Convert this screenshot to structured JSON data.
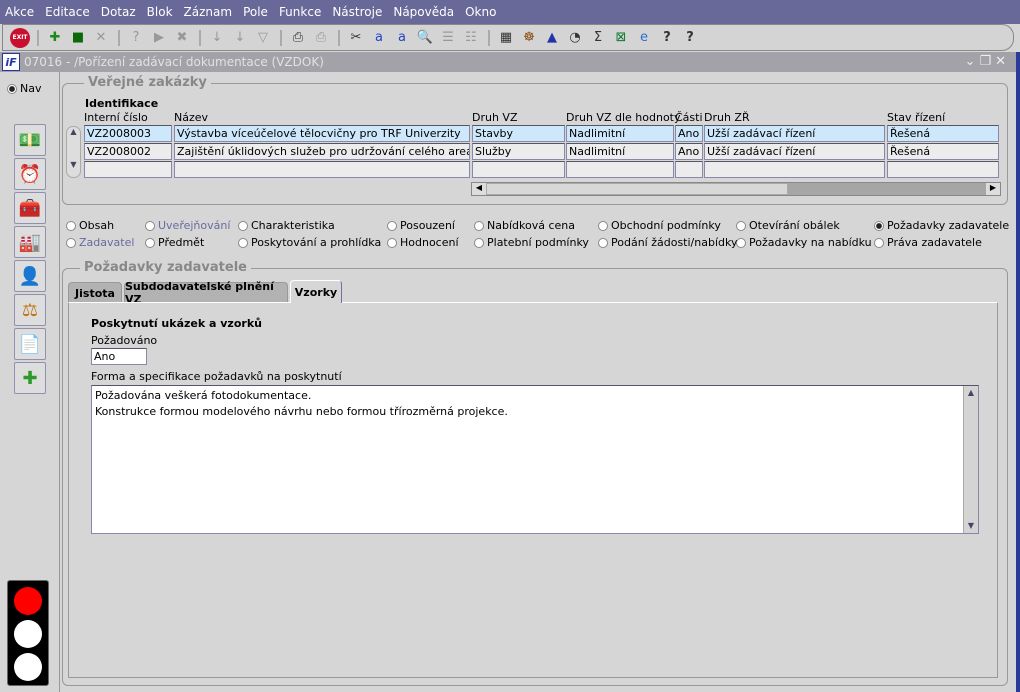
{
  "menu": [
    "Akce",
    "Editace",
    "Dotaz",
    "Blok",
    "Záznam",
    "Pole",
    "Funkce",
    "Nástroje",
    "Nápověda",
    "Okno"
  ],
  "toolbar": {
    "exit_label": "EXIT",
    "icons": [
      "exit-icon",
      "insert-record-icon",
      "save-icon",
      "delete-record-icon",
      "query-help-icon",
      "execute-query-icon",
      "cancel-query-icon",
      "sort-asc-icon",
      "sort-desc-icon",
      "filter-icon",
      "print-icon",
      "print-setup-icon",
      "cut-icon",
      "copy-icon",
      "paste-icon",
      "zoom-icon",
      "list-icon",
      "columns-icon",
      "export-icon",
      "navigator-icon",
      "alert-icon",
      "clock-icon",
      "sum-icon",
      "excel-icon",
      "internet-icon",
      "help-icon",
      "about-icon"
    ]
  },
  "window": {
    "title": "07016 - /Pořízení zadávací dokumentace (VZDOK)",
    "logo": "iF"
  },
  "sidebar": {
    "nav_label": "Nav",
    "buttons": [
      "money-icon",
      "clock-icon",
      "toolbox-icon",
      "factory-icon",
      "person-icon",
      "scales-icon",
      "document-icon",
      "new-document-icon"
    ]
  },
  "traffic_light": {
    "active": "red",
    "colors": {
      "red": "#ff0000",
      "off": "#ffffff"
    }
  },
  "zakazky": {
    "title": "Veřejné zakázky",
    "section": "Identifikace",
    "columns": [
      "Interní číslo",
      "Název",
      "Druh VZ",
      "Druh VZ dle hodnoty",
      "Části",
      "Druh ZŘ",
      "Stav řízení"
    ],
    "rows": [
      [
        "VZ2008003",
        "Výstavba víceúčelové tělocvičny pro TRF Univerzity",
        "Stavby",
        "Nadlimitní",
        "Ano",
        "Užší zadávací řízení",
        "Řešená"
      ],
      [
        "VZ2008002",
        "Zajištění úklidových služeb pro udržování celého areálu Univ",
        "Služby",
        "Nadlimitní",
        "Ano",
        "Užší zadávací řízení",
        "Řešená"
      ],
      [
        "",
        "",
        "",
        "",
        "",
        "",
        ""
      ]
    ]
  },
  "sections": [
    [
      {
        "label": "Obsah"
      },
      {
        "label": "Uveřejňování",
        "disabled": true
      },
      {
        "label": "Charakteristika"
      },
      {
        "label": "Posouzení"
      },
      {
        "label": "Nabídková cena"
      },
      {
        "label": "Obchodní podmínky"
      },
      {
        "label": "Otevírání obálek"
      },
      {
        "label": "Požadavky zadavatele",
        "selected": true
      }
    ],
    [
      {
        "label": "Zadavatel",
        "disabled": true
      },
      {
        "label": "Předmět"
      },
      {
        "label": "Poskytování a prohlídka"
      },
      {
        "label": "Hodnocení"
      },
      {
        "label": "Platební podmínky"
      },
      {
        "label": "Podání žádosti/nabídky"
      },
      {
        "label": "Požadavky na nabídku"
      },
      {
        "label": "Práva zadavatele"
      }
    ]
  ],
  "pozadavky": {
    "title": "Požadavky zadavatele",
    "tabs": [
      "Jistota",
      "Subdodavatelské plnění VZ",
      "Vzorky"
    ],
    "active_tab": "Vzorky",
    "heading": "Poskytnutí ukázek a vzorků",
    "pozadovano_label": "Požadováno",
    "pozadovano_value": "Ano",
    "forma_label": "Forma a specifikace požadavků na poskytnutí",
    "forma_lines": [
      "Požadována veškerá fotodokumentace.",
      "Konstrukce formou modelového návrhu nebo formou třírozměrná projekce."
    ]
  },
  "colors": {
    "menubar": "#686899",
    "selected_row": "#cde8fb",
    "titlebar": "#a2a2a8"
  }
}
